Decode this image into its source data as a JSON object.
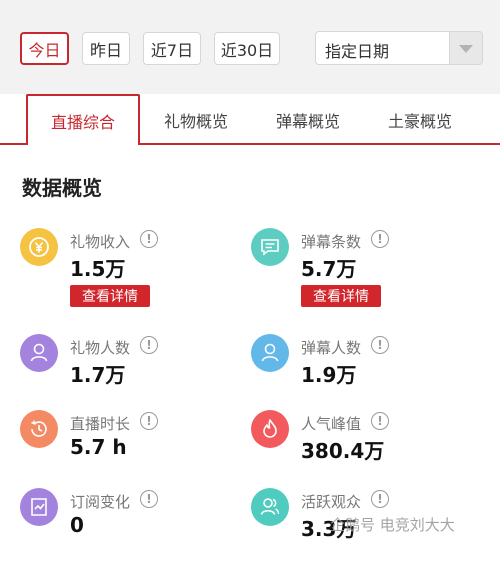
{
  "filters": {
    "today": "今日",
    "yesterday": "昨日",
    "last7": "近7日",
    "last30": "近30日",
    "date_select": "指定日期",
    "active": "today"
  },
  "tabs": [
    "直播综合",
    "礼物概览",
    "弹幕概览",
    "土豪概览"
  ],
  "active_tab": 0,
  "section_title": "数据概览",
  "metrics": [
    {
      "label": "礼物收入",
      "value": "1.5万",
      "button": "查看详情",
      "icon": "yuan-coin-icon",
      "color": "#f5c242"
    },
    {
      "label": "弹幕条数",
      "value": "5.7万",
      "button": "查看详情",
      "icon": "chat-bubble-icon",
      "color": "#5ccdc0"
    },
    {
      "label": "礼物人数",
      "value": "1.7万",
      "icon": "user-icon",
      "color": "#a483df"
    },
    {
      "label": "弹幕人数",
      "value": "1.9万",
      "icon": "user-icon",
      "color": "#62b8e8"
    },
    {
      "label": "直播时长",
      "value": "5.7 h",
      "icon": "clock-icon",
      "color": "#f48a63"
    },
    {
      "label": "人气峰值",
      "value": "380.4万",
      "icon": "flame-icon",
      "color": "#f25a5e"
    },
    {
      "label": "订阅变化",
      "value": "0",
      "icon": "subscribe-icon",
      "color": "#a483df"
    },
    {
      "label": "活跃观众",
      "value": "3.3万",
      "icon": "users-icon",
      "color": "#4fcbc0"
    }
  ],
  "info_glyph": "!",
  "watermark": "企鹅号 电竞刘大大"
}
